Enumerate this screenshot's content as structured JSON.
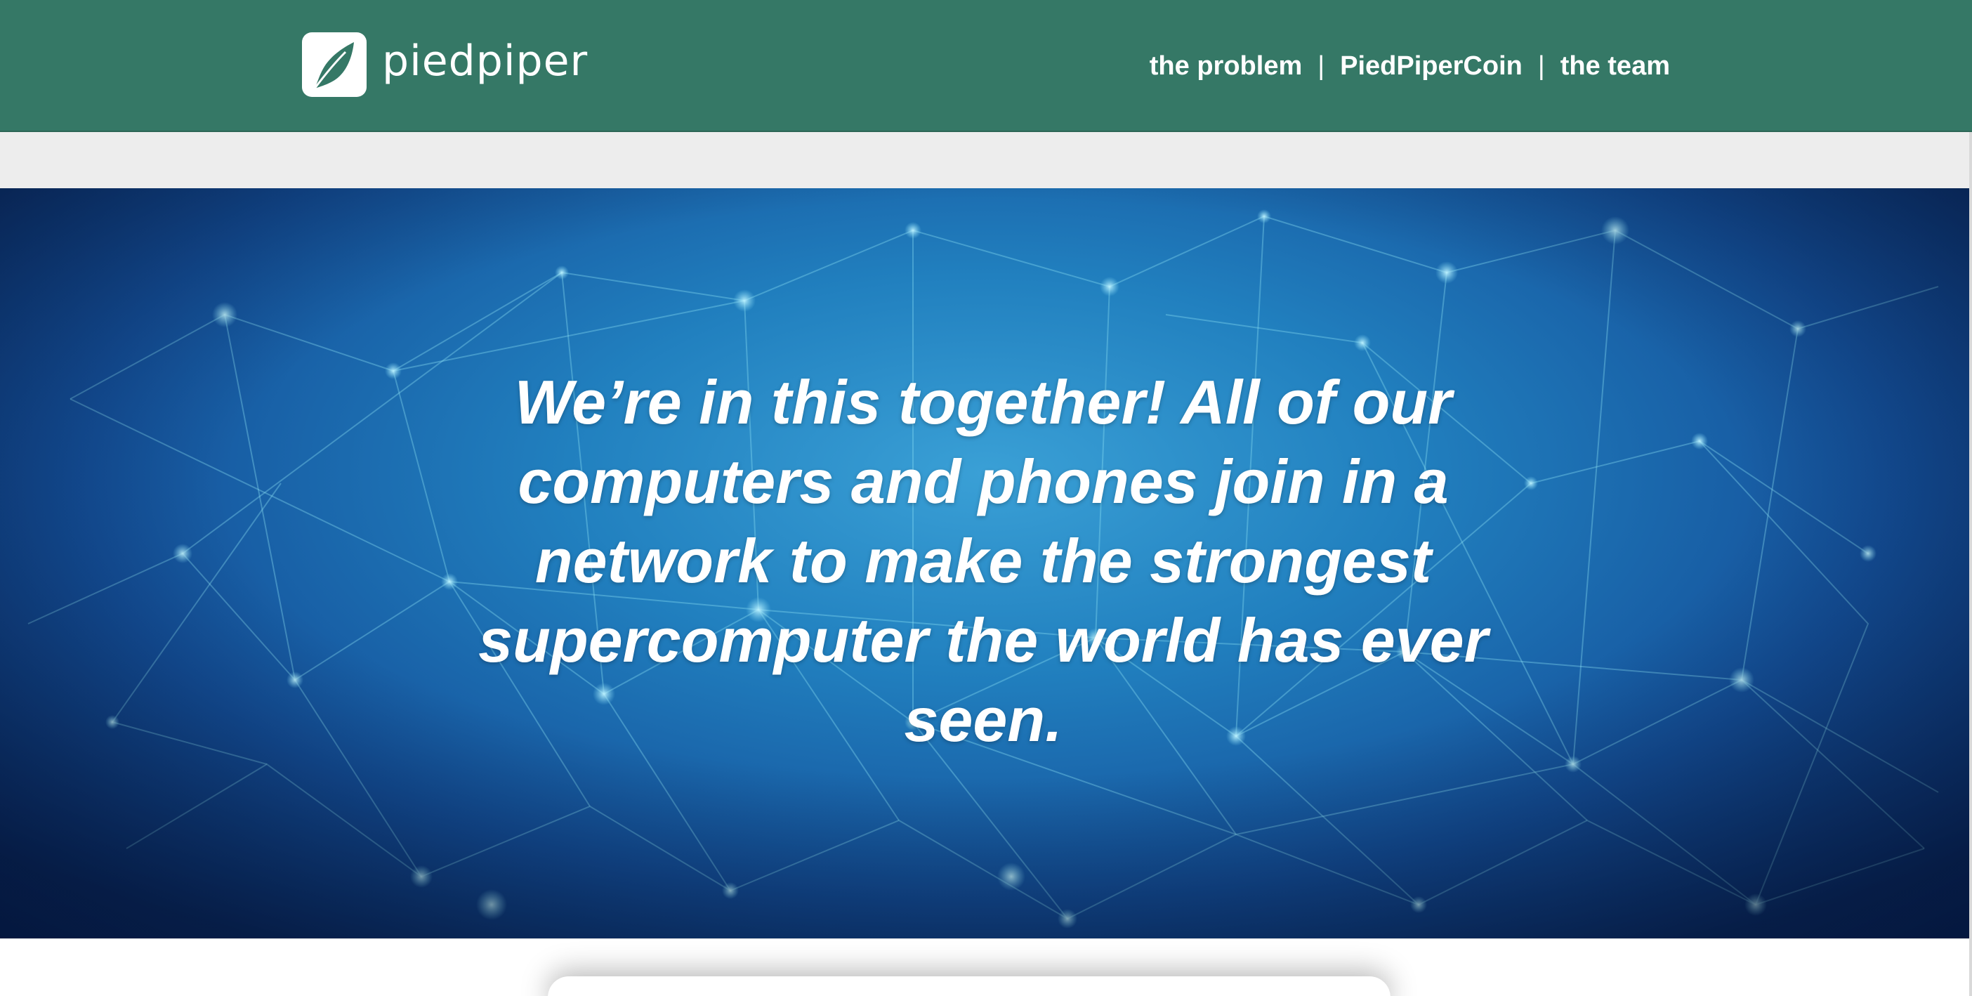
{
  "brand": {
    "name": "piedpiper",
    "color": "#357866"
  },
  "nav": {
    "items": [
      {
        "label": "the problem"
      },
      {
        "label": "PiedPiperCoin"
      },
      {
        "label": "the team"
      }
    ],
    "separator": "|"
  },
  "hero": {
    "headline": "We’re in this together! All of our computers and phones join in a network to make the strongest supercomputer the world has ever seen.",
    "background_color": "#1e6fb3"
  }
}
